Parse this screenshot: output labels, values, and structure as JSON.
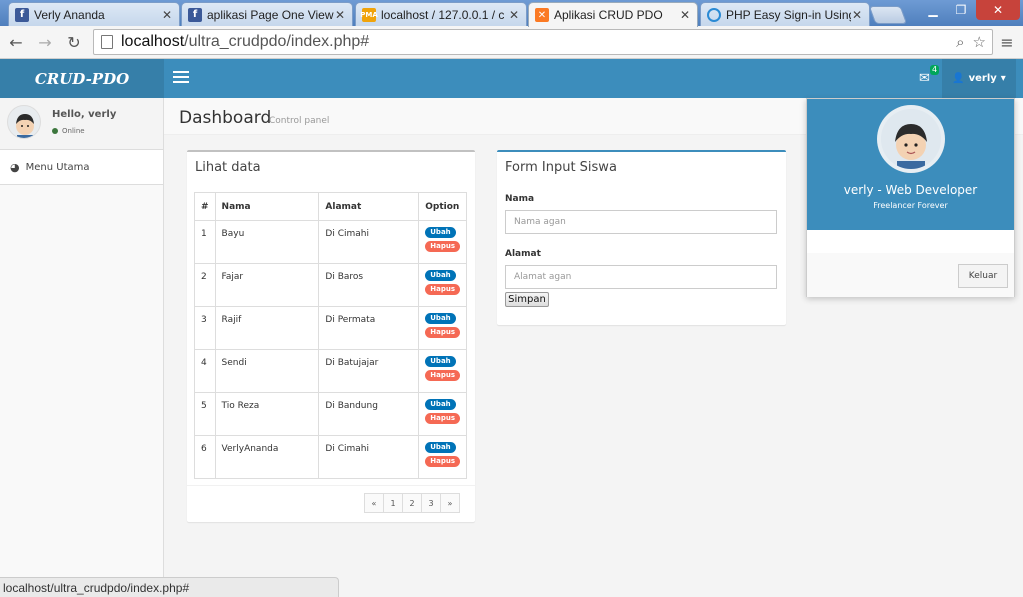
{
  "browser": {
    "tabs": [
      {
        "label": "Verly Ananda",
        "icon": "facebook-icon",
        "color": "#3b5998"
      },
      {
        "label": "aplikasi Page One View",
        "icon": "facebook-icon",
        "color": "#3b5998"
      },
      {
        "label": "localhost / 127.0.0.1 / c",
        "icon": "phpmyadmin-icon",
        "color": "#f0a30a"
      },
      {
        "label": "Aplikasi CRUD PDO",
        "icon": "xampp-icon",
        "color": "#fb7a24"
      },
      {
        "label": "PHP Easy Sign-in Using",
        "icon": "loading-icon",
        "color": "#2a8ad4"
      }
    ],
    "url_host": "localhost",
    "url_path": "/ultra_crudpdo/index.php#",
    "status_url": "localhost/ultra_crudpdo/index.php#"
  },
  "app": {
    "logo": "CRUD-PDO",
    "mail_count": "4",
    "username": "verly"
  },
  "sidebar": {
    "hello": "Hello, verly",
    "status": "Online",
    "menu": "Menu Utama"
  },
  "content": {
    "title": "Dashboard",
    "subtitle": "Control panel"
  },
  "table_box": {
    "title": "Lihat data",
    "headers": [
      "#",
      "Nama",
      "Alamat",
      "Option"
    ],
    "rows": [
      {
        "no": "1",
        "nama": "Bayu",
        "alamat": "Di Cimahi"
      },
      {
        "no": "2",
        "nama": "Fajar",
        "alamat": "Di Baros"
      },
      {
        "no": "3",
        "nama": "Rajif",
        "alamat": "Di Permata"
      },
      {
        "no": "4",
        "nama": "Sendi",
        "alamat": "Di Batujajar"
      },
      {
        "no": "5",
        "nama": "Tio Reza",
        "alamat": "Di Bandung"
      },
      {
        "no": "6",
        "nama": "VerlyAnanda",
        "alamat": "Di Cimahi"
      }
    ],
    "edit_label": "Ubah",
    "delete_label": "Hapus",
    "pager": [
      "«",
      "1",
      "2",
      "3",
      "»"
    ]
  },
  "form_box": {
    "title": "Form Input Siswa",
    "nama_label": "Nama",
    "nama_placeholder": "Nama agan",
    "alamat_label": "Alamat",
    "alamat_placeholder": "Alamat agan",
    "submit": "Simpan"
  },
  "dropdown": {
    "name": "verly - Web Developer",
    "tagline": "Freelancer Forever",
    "logout": "Keluar"
  },
  "colors": {
    "header": "#3c8dbc",
    "logo_bg": "#367fa9",
    "edit_badge": "#0073b7",
    "delete_badge": "#f56954"
  }
}
